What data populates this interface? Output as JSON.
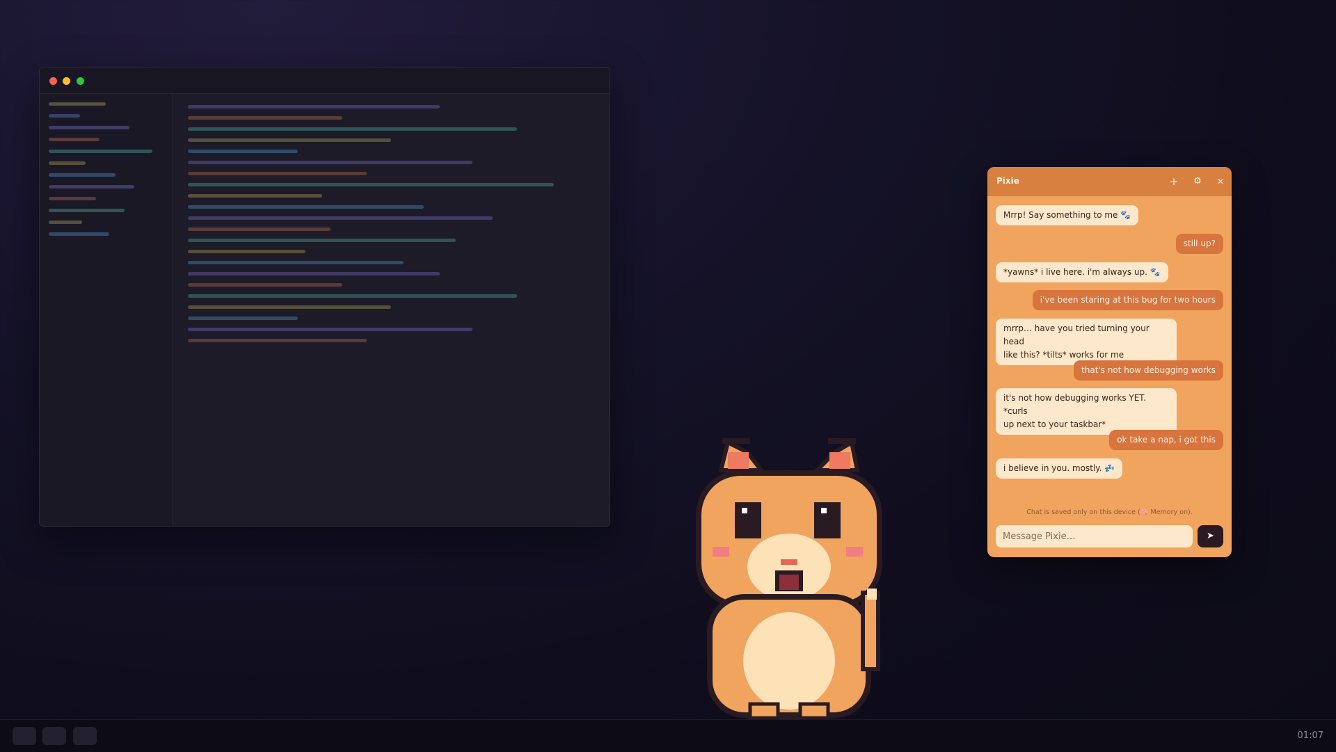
{
  "chat": {
    "title": "Pixie",
    "header_icons": [
      "plus-icon",
      "gear-icon",
      "close-icon"
    ],
    "header_glyphs": {
      "add": "+",
      "settings": "⚙",
      "close": "✕"
    },
    "messages": [
      {
        "role": "bot",
        "text": "Mrrp! Say something to me 🐾"
      },
      {
        "role": "user",
        "text": "still up?"
      },
      {
        "role": "bot",
        "text": "*yawns* i live here. i'm always up. 🐾"
      },
      {
        "role": "user",
        "text": "i've been staring at this bug for two hours"
      },
      {
        "role": "bot",
        "text": "mrrp… have you tried turning your head\nlike this? *tilts* works for me"
      },
      {
        "role": "user",
        "text": "that's not how debugging works"
      },
      {
        "role": "bot",
        "text": "it's not how debugging works YET. *curls\nup next to your taskbar*"
      },
      {
        "role": "user",
        "text": "ok take a nap, i got this"
      },
      {
        "role": "bot",
        "text": "i believe in you. mostly. 💤"
      }
    ],
    "footer_note": "Chat is saved only on this device (🧠 Memory on).",
    "input_placeholder": "Message Pixie…",
    "send_glyph": "➤"
  },
  "taskbar": {
    "clock": "01:07"
  },
  "colors": {
    "panel_bg": "#f0a45e",
    "header_bg": "#d7803f",
    "bot_bubble": "#fde8cc",
    "user_bubble": "#d8743d",
    "send_button": "#2a1a22"
  }
}
